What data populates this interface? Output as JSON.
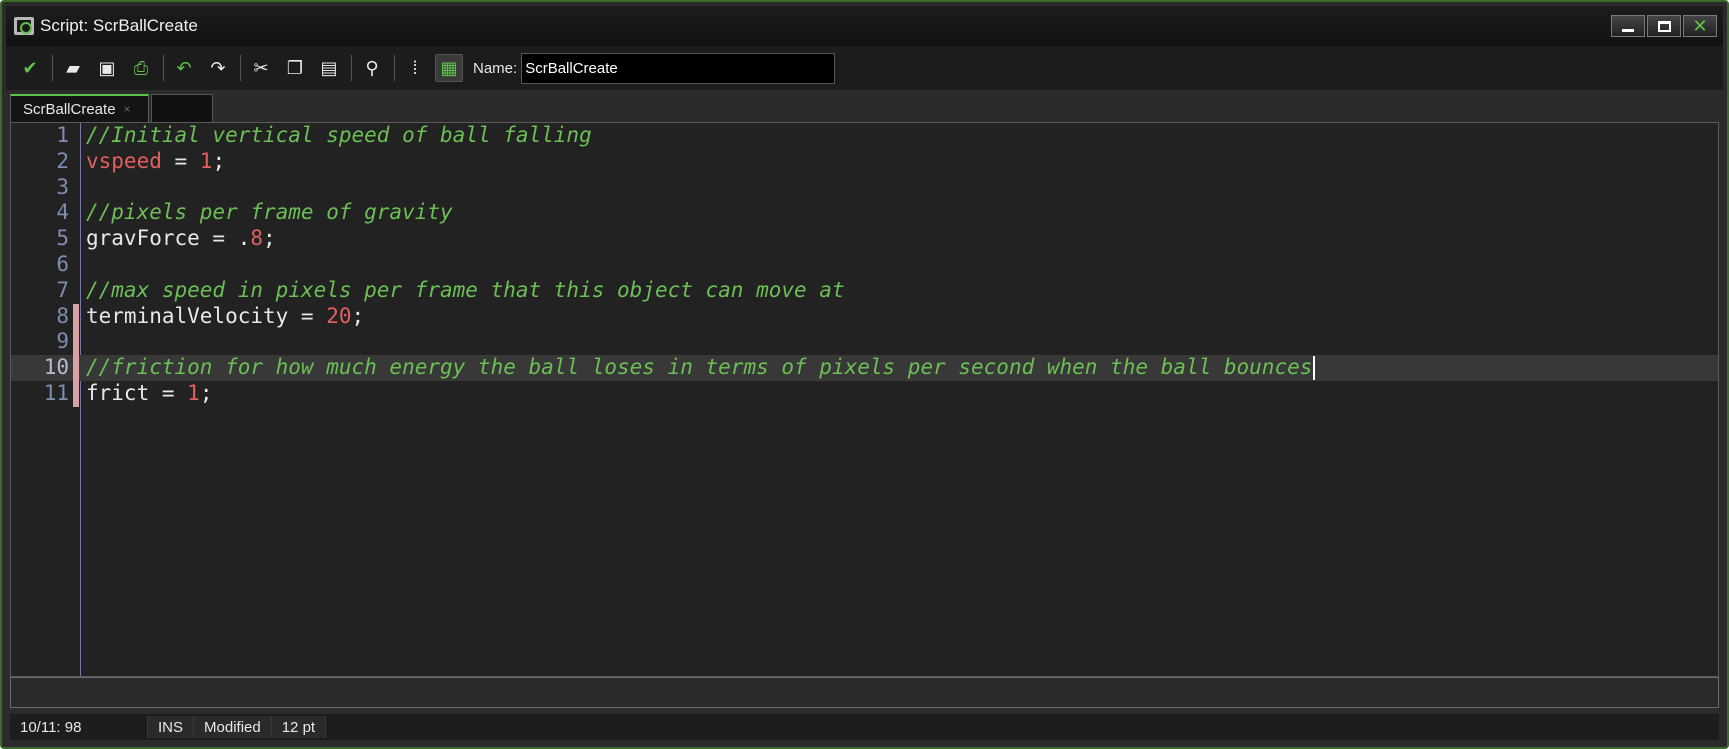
{
  "window": {
    "title": "Script: ScrBallCreate",
    "accent_color": "#5fc24a"
  },
  "toolbar": {
    "buttons": [
      {
        "name": "confirm-button",
        "icon": "checkmark-icon"
      },
      {
        "name": "open-button",
        "icon": "folder-open-icon"
      },
      {
        "name": "save-button",
        "icon": "floppy-icon"
      },
      {
        "name": "print-button",
        "icon": "printer-icon"
      },
      {
        "name": "undo-button",
        "icon": "undo-icon"
      },
      {
        "name": "redo-button",
        "icon": "redo-icon"
      },
      {
        "name": "cut-button",
        "icon": "scissors-icon"
      },
      {
        "name": "copy-button",
        "icon": "copy-icon"
      },
      {
        "name": "paste-button",
        "icon": "clipboard-icon"
      },
      {
        "name": "find-button",
        "icon": "magnifier-icon"
      },
      {
        "name": "goto-line-button",
        "icon": "list-icon"
      },
      {
        "name": "code-snippet-button",
        "icon": "document-icon"
      }
    ],
    "name_label": "Name:",
    "name_value": "ScrBallCreate"
  },
  "tabs": [
    {
      "label": "ScrBallCreate",
      "close": "×",
      "active": true
    }
  ],
  "editor": {
    "lines": [
      {
        "num": "1",
        "tokens": [
          {
            "t": "comment",
            "v": "//Initial vertical speed of ball falling"
          }
        ]
      },
      {
        "num": "2",
        "tokens": [
          {
            "t": "var",
            "v": "vspeed"
          },
          {
            "t": "plain",
            "v": " = "
          },
          {
            "t": "num",
            "v": "1"
          },
          {
            "t": "plain",
            "v": ";"
          }
        ]
      },
      {
        "num": "3",
        "tokens": []
      },
      {
        "num": "4",
        "tokens": [
          {
            "t": "comment",
            "v": "//pixels per frame of gravity"
          }
        ]
      },
      {
        "num": "5",
        "tokens": [
          {
            "t": "plain",
            "v": "gravForce = ."
          },
          {
            "t": "num",
            "v": "8"
          },
          {
            "t": "plain",
            "v": ";"
          }
        ]
      },
      {
        "num": "6",
        "tokens": []
      },
      {
        "num": "7",
        "tokens": [
          {
            "t": "comment",
            "v": "//max speed in pixels per frame that this object can move at"
          }
        ]
      },
      {
        "num": "8",
        "tokens": [
          {
            "t": "plain",
            "v": "terminalVelocity = "
          },
          {
            "t": "num",
            "v": "20"
          },
          {
            "t": "plain",
            "v": ";"
          }
        ],
        "modified": true
      },
      {
        "num": "9",
        "tokens": [],
        "modified": true
      },
      {
        "num": "10",
        "tokens": [
          {
            "t": "comment",
            "v": "//friction for how much energy the ball loses in terms of pixels per second when the ball bounces"
          }
        ],
        "modified": true,
        "current": true
      },
      {
        "num": "11",
        "tokens": [
          {
            "t": "plain",
            "v": "frict = "
          },
          {
            "t": "num",
            "v": "1"
          },
          {
            "t": "plain",
            "v": ";"
          }
        ],
        "modified": true
      }
    ]
  },
  "status": {
    "position": "10/11: 98",
    "mode": "INS",
    "modified": "Modified",
    "font_size": "12 pt"
  }
}
